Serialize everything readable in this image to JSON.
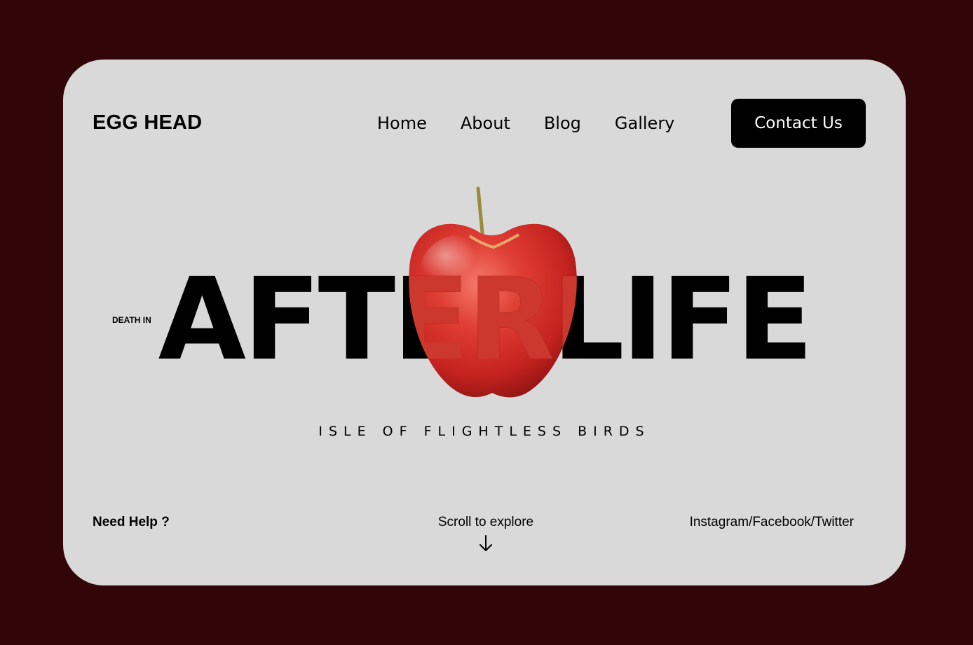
{
  "header": {
    "brand": "EGG HEAD",
    "nav": [
      "Home",
      "About",
      "Blog",
      "Gallery"
    ],
    "cta_label": "Contact Us"
  },
  "hero": {
    "tag": "DEATH IN",
    "title": "AFTERLIFE",
    "subtitle": "ISLE OF FLIGHTLESS BIRDS",
    "image_icon": "apple-icon"
  },
  "footer": {
    "help": "Need Help ?",
    "scroll": "Scroll to explore",
    "scroll_icon": "arrow-down-icon",
    "social": "Instagram/Facebook/Twitter"
  },
  "colors": {
    "page_background": "#320609",
    "card_background": "#d9d9d9",
    "text": "#000000",
    "button_background": "#000000",
    "button_text": "#ffffff",
    "apple_red": "#d8342c"
  }
}
